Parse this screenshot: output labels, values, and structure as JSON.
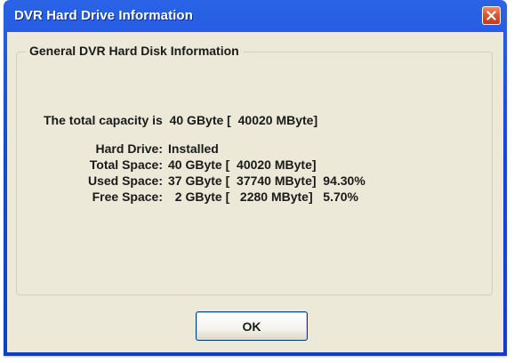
{
  "window": {
    "title": "DVR Hard Drive Information",
    "close_icon": "close-icon",
    "colors": {
      "titlebar": "#1749d8",
      "client": "#ece9d8",
      "close_button": "#e0502e"
    }
  },
  "group": {
    "title": "General DVR Hard Disk Information"
  },
  "capacity_line": "The total capacity is  40 GByte [  40020 MByte]",
  "info": {
    "hard_drive": {
      "label": "Hard Drive:",
      "value": "Installed"
    },
    "total_space": {
      "label": "Total Space:",
      "value": "40 GByte [  40020 MByte]"
    },
    "used_space": {
      "label": "Used Space:",
      "value": "37 GByte [  37740 MByte]  94.30%"
    },
    "free_space": {
      "label": "Free Space:",
      "value": "  2 GByte [   2280 MByte]   5.70%"
    }
  },
  "buttons": {
    "ok_label": "OK"
  }
}
